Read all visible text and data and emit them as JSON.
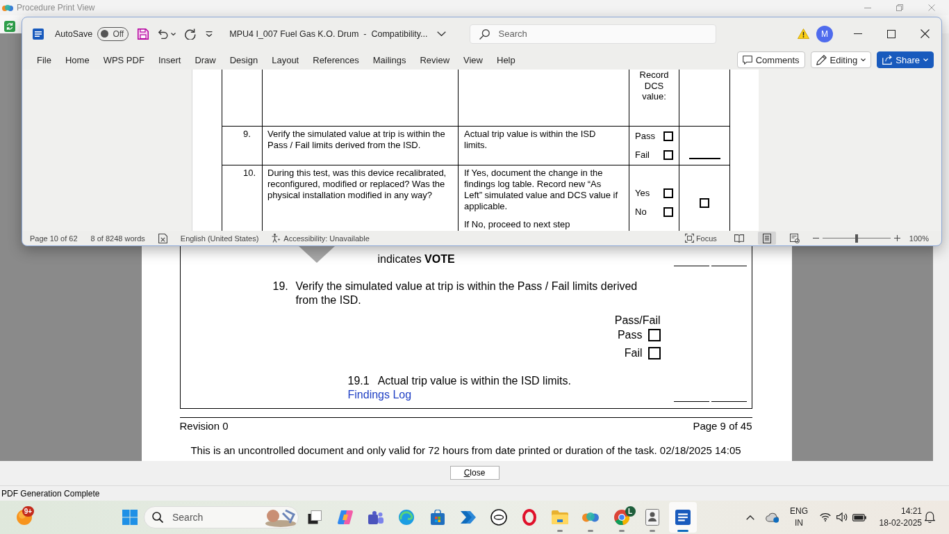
{
  "background_window": {
    "title": "Procedure Print View"
  },
  "word_window": {
    "autosave": {
      "label": "AutoSave",
      "state": "Off",
      "on": false
    },
    "document_title": "MPU4 I_007 Fuel Gas K.O. Drum  -  Compatibility...",
    "search": {
      "placeholder": "Search"
    },
    "account": "M",
    "ribbon_tabs": [
      {
        "label": "File",
        "selected": false
      },
      {
        "label": "Home",
        "selected": false
      },
      {
        "label": "WPS PDF",
        "selected": false
      },
      {
        "label": "Insert",
        "selected": false
      },
      {
        "label": "Draw",
        "selected": false
      },
      {
        "label": "Design",
        "selected": false
      },
      {
        "label": "Layout",
        "selected": false
      },
      {
        "label": "References",
        "selected": false
      },
      {
        "label": "Mailings",
        "selected": false
      },
      {
        "label": "Review",
        "selected": false
      },
      {
        "label": "View",
        "selected": false
      },
      {
        "label": "Help",
        "selected": false
      }
    ],
    "actions": [
      {
        "kind": "comments",
        "label": "Comments"
      },
      {
        "kind": "editing",
        "label": "Editing"
      },
      {
        "kind": "share",
        "label": "Share"
      }
    ],
    "table": {
      "rows": [
        {
          "kind": "record",
          "result": "Record DCS value:"
        },
        {
          "kind": "check",
          "number": "9.",
          "step": "Verify the simulated value at trip is within the Pass / Fail limits derived from the ISD.",
          "criteria": [
            "Actual trip value is within the ISD limits."
          ],
          "options": [
            {
              "label": "Pass",
              "checked": false
            },
            {
              "label": "Fail",
              "checked": false
            }
          ],
          "signoff": {
            "kind": "line"
          }
        },
        {
          "kind": "check",
          "number": "10.",
          "step": "During this test, was this device recalibrated, reconfigured, modified or replaced? Was the physical installation modified in any way?",
          "criteria": [
            "If Yes, document the change in the findings log table. Record new “As Left” simulated value and DCS value if applicable.",
            "If No, proceed to next step"
          ],
          "options": [
            {
              "label": "Yes",
              "checked": false
            },
            {
              "label": "No",
              "checked": false
            }
          ],
          "signoff": {
            "kind": "checkbox",
            "checked": false
          }
        }
      ]
    },
    "status_bar": {
      "page": "Page 10 of 62",
      "words": "8 of 8248 words",
      "language": "English (United States)",
      "accessibility": "Accessibility: Unavailable",
      "focus": "Focus",
      "views": [
        {
          "kind": "read_mode",
          "selected": false
        },
        {
          "kind": "print_layout",
          "selected": true
        },
        {
          "kind": "web_layout",
          "selected": false
        }
      ],
      "zoom": {
        "level": 0.5,
        "reading": "100%"
      }
    }
  },
  "document_page": {
    "previous_step": {
      "text": "indicates **VOTE**",
      "signoffs": [
        {
          "kind": "line"
        },
        {
          "kind": "line"
        }
      ]
    },
    "step": {
      "number": "19.",
      "text": "Verify the simulated value at trip is within the Pass / Fail limits derived from the ISD.",
      "result_heading": "Pass/Fail",
      "options": [
        {
          "label": "Pass",
          "checked": false
        },
        {
          "label": "Fail",
          "checked": false
        }
      ]
    },
    "substep": {
      "number": "19.1",
      "text": "Actual trip value is within the ISD limits.",
      "link": "Findings Log",
      "signoffs": [
        {
          "kind": "line"
        },
        {
          "kind": "line"
        }
      ]
    },
    "footer": {
      "revision": "Revision 0",
      "page": "Page 9 of 45",
      "disclaimer": "This is an uncontrolled document and only valid for 72 hours from date printed or duration of the task. 02/18/2025 14:05"
    }
  },
  "dialog": {
    "close_button": "Close",
    "status": "PDF Generation Complete"
  },
  "taskbar": {
    "widgets": {
      "badge": "9+"
    },
    "search": {
      "placeholder": "Search"
    },
    "apps": [
      {
        "kind": "task_view",
        "running": false,
        "selected": false
      },
      {
        "kind": "copilot",
        "running": false,
        "selected": false
      },
      {
        "kind": "teams",
        "running": false,
        "selected": false
      },
      {
        "kind": "edge",
        "running": false,
        "selected": false
      },
      {
        "kind": "store",
        "running": false,
        "selected": false
      },
      {
        "kind": "automate",
        "running": false,
        "selected": false
      },
      {
        "kind": "dell",
        "running": false,
        "selected": false
      },
      {
        "kind": "opera",
        "running": false,
        "selected": false
      },
      {
        "kind": "explorer",
        "running": true,
        "selected": false
      },
      {
        "kind": "cluster",
        "running": true,
        "selected": false
      },
      {
        "kind": "chrome",
        "running": true,
        "selected": false,
        "badge": "L"
      },
      {
        "kind": "id_card",
        "running": true,
        "selected": false
      },
      {
        "kind": "word",
        "running": true,
        "selected": true
      }
    ],
    "tray": {
      "language": "ENG",
      "region": "IN",
      "time": "14:21",
      "date": "18-02-2025"
    }
  }
}
